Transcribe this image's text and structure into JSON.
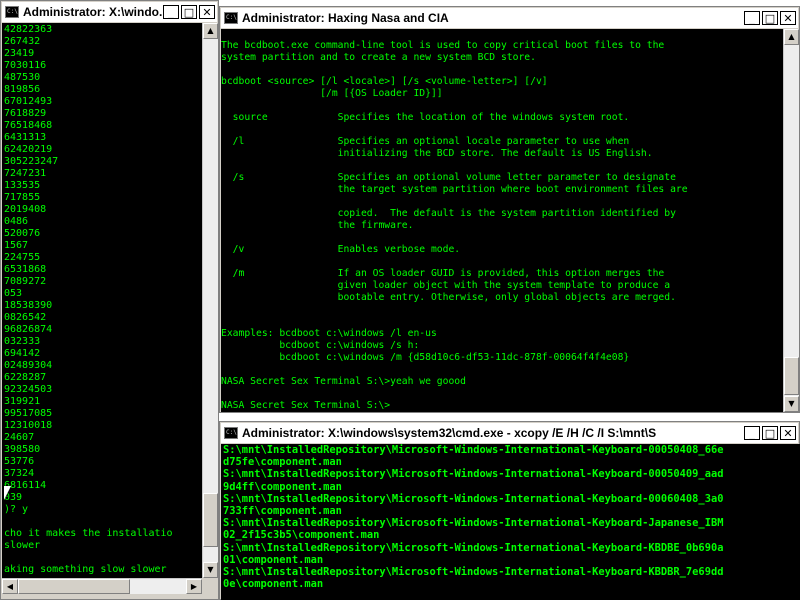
{
  "windows": {
    "left": {
      "title": "Administrator: X:\\windo...",
      "lines": [
        "42822363",
        "267432",
        "23419",
        "7030116",
        "487530",
        "819856",
        "67012493",
        "7618829",
        "76518468",
        "6431313",
        "62420219",
        "305223247",
        "7247231",
        "133535",
        "717855",
        "2019408",
        "0486",
        "520076",
        "1567",
        "224755",
        "6531868",
        "7089272",
        "053",
        "18538390",
        "0826542",
        "96826874",
        "032333",
        "694142",
        "02489304",
        "6228287",
        "92324503",
        "319921",
        "99517085",
        "12310018",
        "24607",
        "398580",
        "53776",
        "37324",
        "6816114",
        "039",
        ")? y",
        "",
        "cho it makes the installatio",
        "slower",
        "",
        "aking something slow slower"
      ]
    },
    "main": {
      "title": "Administrator:  Haxing Nasa and CIA",
      "lines": [
        "The bcdboot.exe command-line tool is used to copy critical boot files to the",
        "system partition and to create a new system BCD store.",
        "",
        "bcdboot <source> [/l <locale>] [/s <volume-letter>] [/v]",
        "                 [/m [{OS Loader ID}]]",
        "",
        "  source            Specifies the location of the windows system root.",
        "",
        "  /l                Specifies an optional locale parameter to use when",
        "                    initializing the BCD store. The default is US English.",
        "",
        "  /s                Specifies an optional volume letter parameter to designate",
        "                    the target system partition where boot environment files are",
        "",
        "                    copied.  The default is the system partition identified by",
        "                    the firmware.",
        "",
        "  /v                Enables verbose mode.",
        "",
        "  /m                If an OS loader GUID is provided, this option merges the",
        "                    given loader object with the system template to produce a",
        "                    bootable entry. Otherwise, only global objects are merged.",
        "",
        "",
        "Examples: bcdboot c:\\windows /l en-us",
        "          bcdboot c:\\windows /s h:",
        "          bcdboot c:\\windows /m {d58d10c6-df53-11dc-878f-00064f4f4e08}",
        "",
        "NASA Secret Sex Terminal S:\\>yeah we goood",
        "",
        "NASA Secret Sex Terminal S:\\>"
      ]
    },
    "xcopy": {
      "title": "Administrator: X:\\windows\\system32\\cmd.exe - xcopy  /E /H /C /I S:\\mnt\\S",
      "lines": [
        "S:\\mnt\\InstalledRepository\\Microsoft-Windows-International-Keyboard-00050408_66e",
        "d75fe\\component.man",
        "S:\\mnt\\InstalledRepository\\Microsoft-Windows-International-Keyboard-00050409_aad",
        "9d4ff\\component.man",
        "S:\\mnt\\InstalledRepository\\Microsoft-Windows-International-Keyboard-00060408_3a0",
        "733ff\\component.man",
        "S:\\mnt\\InstalledRepository\\Microsoft-Windows-International-Keyboard-Japanese_IBM",
        "02_2f15c3b5\\component.man",
        "S:\\mnt\\InstalledRepository\\Microsoft-Windows-International-Keyboard-KBDBE_0b690a",
        "01\\component.man",
        "S:\\mnt\\InstalledRepository\\Microsoft-Windows-International-Keyboard-KBDBR_7e69dd",
        "0e\\component.man"
      ]
    }
  },
  "icons": {
    "minimize": "_",
    "maximize": "□",
    "close": "✕",
    "scroll_up": "▲",
    "scroll_down": "▼",
    "scroll_left": "◀",
    "scroll_right": "▶"
  },
  "colors": {
    "console_bg": "#000000",
    "console_text": "#00ff00",
    "titlebar_bg": "#ffffff",
    "frame": "#d4d0c8"
  }
}
